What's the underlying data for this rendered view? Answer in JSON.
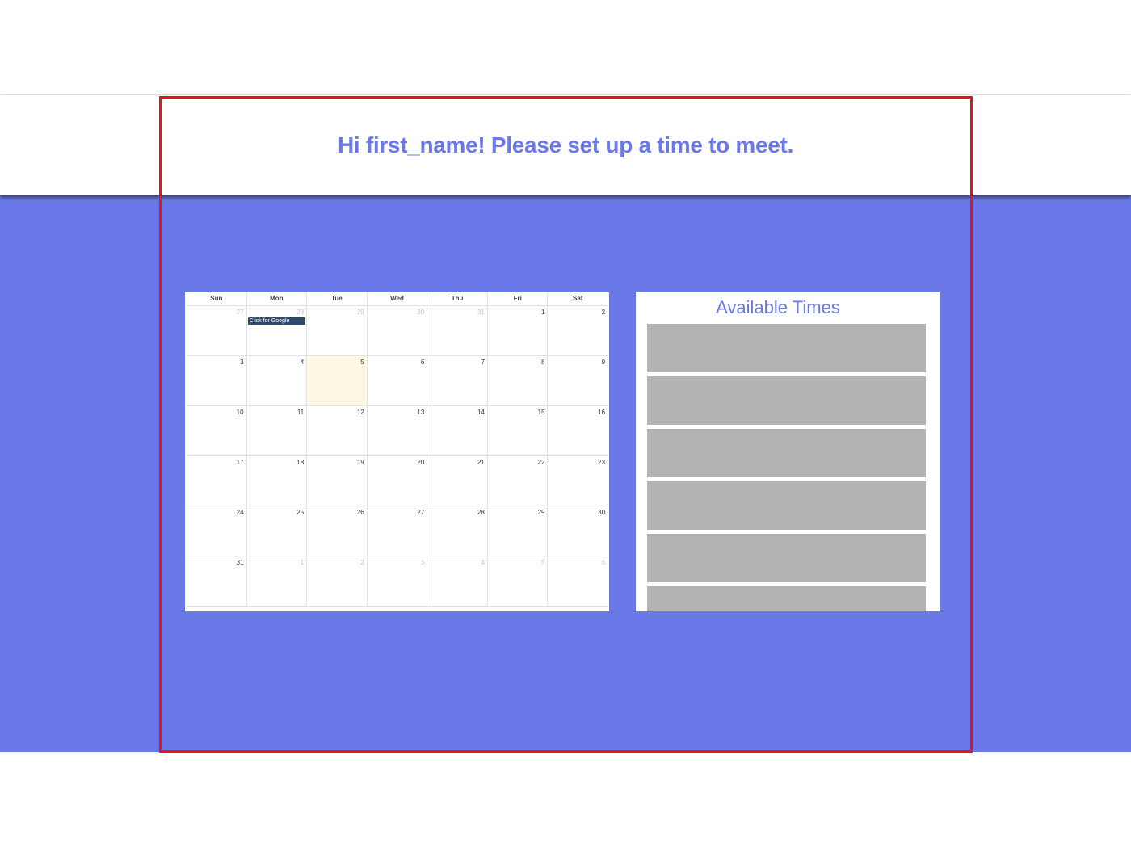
{
  "header": {
    "title": "Hi first_name! Please set up a time to meet."
  },
  "calendar": {
    "weekdays": [
      "Sun",
      "Mon",
      "Tue",
      "Wed",
      "Thu",
      "Fri",
      "Sat"
    ],
    "weeks": [
      [
        {
          "n": "27",
          "other": true
        },
        {
          "n": "28",
          "other": true
        },
        {
          "n": "29",
          "other": true
        },
        {
          "n": "30",
          "other": true
        },
        {
          "n": "31",
          "other": true
        },
        {
          "n": "1"
        },
        {
          "n": "2"
        }
      ],
      [
        {
          "n": "3"
        },
        {
          "n": "4"
        },
        {
          "n": "5",
          "today": true
        },
        {
          "n": "6"
        },
        {
          "n": "7"
        },
        {
          "n": "8"
        },
        {
          "n": "9"
        }
      ],
      [
        {
          "n": "10"
        },
        {
          "n": "11"
        },
        {
          "n": "12"
        },
        {
          "n": "13"
        },
        {
          "n": "14"
        },
        {
          "n": "15"
        },
        {
          "n": "16"
        }
      ],
      [
        {
          "n": "17"
        },
        {
          "n": "18"
        },
        {
          "n": "19"
        },
        {
          "n": "20"
        },
        {
          "n": "21"
        },
        {
          "n": "22"
        },
        {
          "n": "23"
        }
      ],
      [
        {
          "n": "24"
        },
        {
          "n": "25"
        },
        {
          "n": "26"
        },
        {
          "n": "27"
        },
        {
          "n": "28"
        },
        {
          "n": "29"
        },
        {
          "n": "30"
        }
      ],
      [
        {
          "n": "31"
        },
        {
          "n": "1",
          "other": true
        },
        {
          "n": "2",
          "other": true
        },
        {
          "n": "3",
          "other": true
        },
        {
          "n": "4",
          "other": true
        },
        {
          "n": "5",
          "other": true
        },
        {
          "n": "6",
          "other": true
        }
      ]
    ],
    "event": {
      "label": "Click for Google",
      "week": 0,
      "day": 1
    }
  },
  "times": {
    "title": "Available Times",
    "slot_count": 6
  },
  "colors": {
    "accent": "#6b79e8",
    "highlight_frame": "#e8121d",
    "slot": "#b3b3b3",
    "event": "#2f4a6d"
  }
}
